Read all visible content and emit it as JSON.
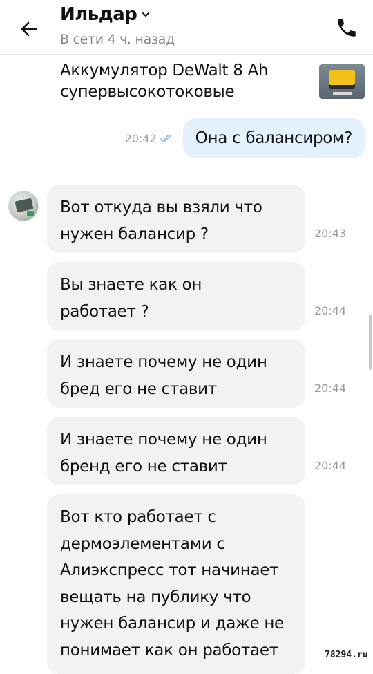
{
  "header": {
    "contact_name": "Ильдар",
    "status": "В сети 4 ч. назад",
    "back_icon": "arrow-left-icon",
    "call_icon": "phone-icon"
  },
  "listing": {
    "title": "Аккумулятор DeWalt 8 Ah супервысокотоковые",
    "thumbnail": "battery-photo"
  },
  "messages": {
    "outgoing": [
      {
        "text": "Она с балансиром?",
        "time": "20:42",
        "read": true
      }
    ],
    "incoming": [
      {
        "text": "Вот откуда вы взяли что нужен балансир ?",
        "time": "20:43"
      },
      {
        "text": "Вы знаете как он работает ?",
        "time": "20:44"
      },
      {
        "text": "И знаете почему не один бред его не ставит",
        "time": "20:44"
      },
      {
        "text": "И знаете почему не один бренд его не ставит",
        "time": "20:44"
      },
      {
        "text": "Вот кто работает с дермоэлементами с Алиэкспресс тот начинает вещать на публику что нужен балансир и даже не понимает как он работает",
        "time": ""
      }
    ]
  },
  "watermark": "78294.ru",
  "colors": {
    "outgoing_bubble": "#e4f1ff",
    "incoming_bubble": "#f2f2f2",
    "read_ticks": "#8fb4e0",
    "timestamp": "#9a9a9a"
  }
}
